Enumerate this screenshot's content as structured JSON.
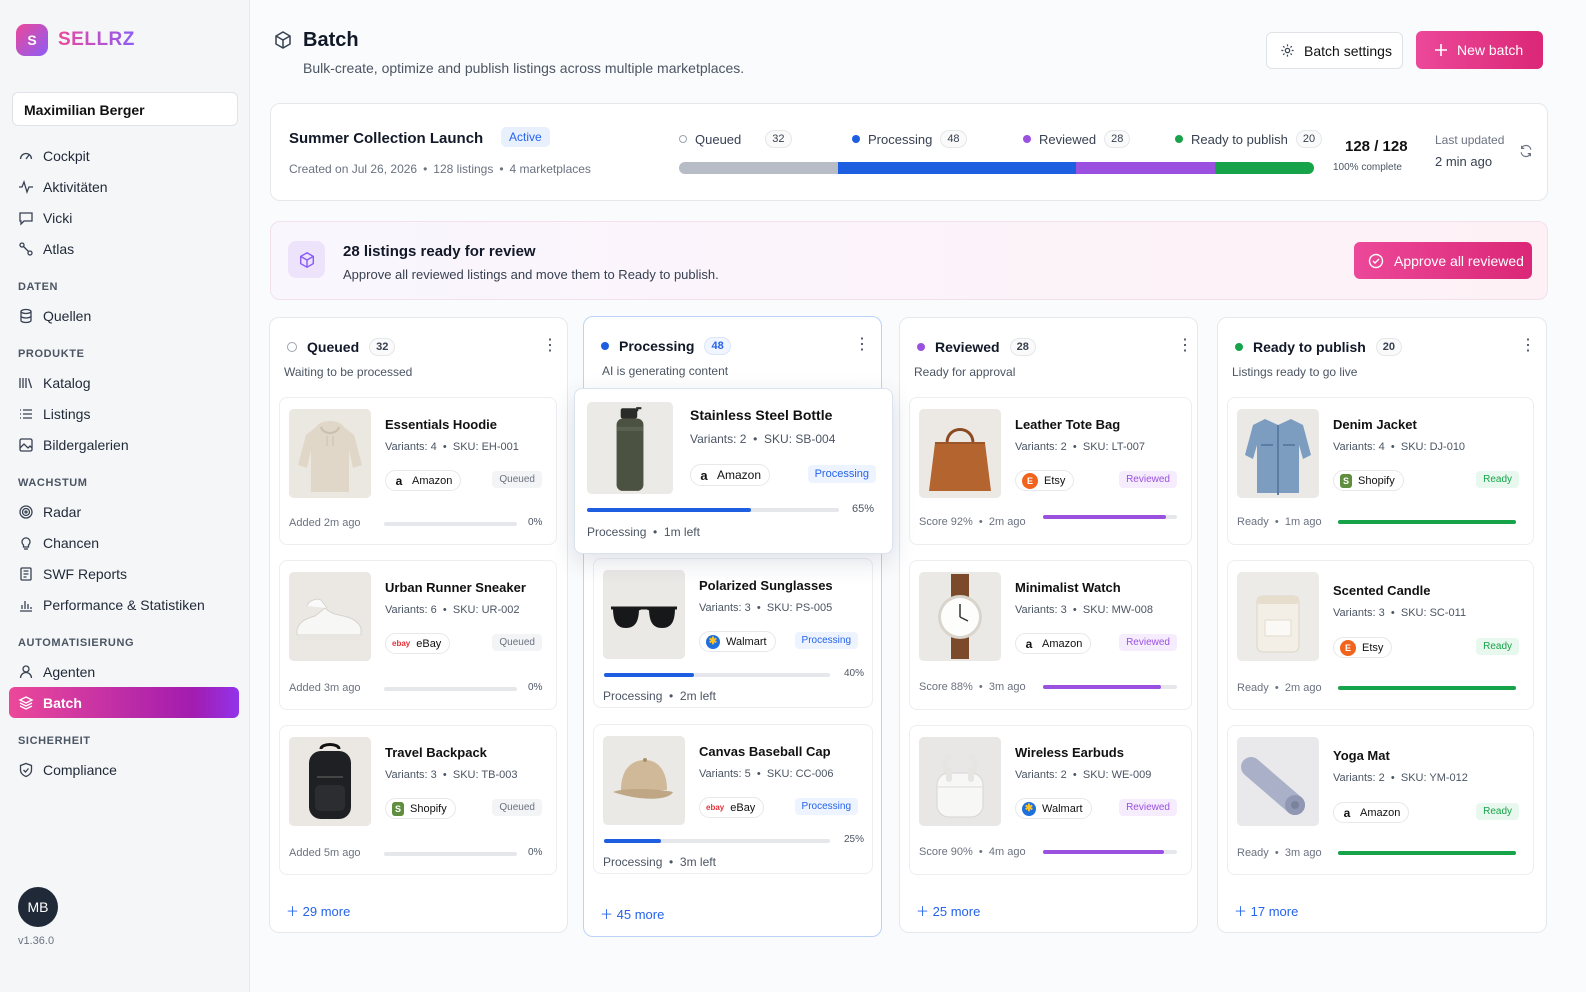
{
  "app": {
    "logo_letter": "S",
    "name": "SELLRZ",
    "user": "Maximilian Berger",
    "avatar": "MB",
    "version": "v1.36.0"
  },
  "nav": {
    "cockpit": "Cockpit",
    "aktivitaeten": "Aktivitäten",
    "vicki": "Vicki",
    "atlas": "Atlas",
    "sec_daten": "DATEN",
    "quellen": "Quellen",
    "sec_produkte": "PRODUKTE",
    "katalog": "Katalog",
    "listings": "Listings",
    "bildergalerien": "Bildergalerien",
    "sec_wachstum": "WACHSTUM",
    "radar": "Radar",
    "chancen": "Chancen",
    "swf": "SWF Reports",
    "perf": "Performance & Statistiken",
    "sec_auto": "AUTOMATISIERUNG",
    "agenten": "Agenten",
    "batch": "Batch",
    "sec_sicherheit": "SICHERHEIT",
    "compliance": "Compliance"
  },
  "header": {
    "title": "Batch",
    "subtitle": "Bulk-create, optimize and publish listings across multiple marketplaces.",
    "settings": "Batch settings",
    "new_batch": "New batch"
  },
  "summary": {
    "name": "Summer Collection Launch",
    "status": "Active",
    "created": "Created on Jul 26, 2026",
    "listings": "128 listings",
    "marketplaces": "4 marketplaces",
    "legend": [
      {
        "label": "Queued",
        "count": "32"
      },
      {
        "label": "Processing",
        "count": "48"
      },
      {
        "label": "Reviewed",
        "count": "28"
      },
      {
        "label": "Ready to publish",
        "count": "20"
      }
    ],
    "segments": [
      32,
      48,
      28,
      20
    ],
    "total": "128 / 128",
    "complete": "100% complete",
    "updated_label": "Last updated",
    "updated_value": "2 min ago"
  },
  "banner": {
    "title": "28 listings ready for review",
    "subtitle": "Approve all reviewed listings and move them to Ready to publish.",
    "button": "Approve all reviewed"
  },
  "columns": {
    "queued": {
      "title": "Queued",
      "count": "32",
      "sub": "Waiting to be processed",
      "more": "29 more",
      "cards": [
        {
          "title": "Essentials Hoodie",
          "variants": "Variants: 4",
          "sku": "SKU: EH-001",
          "market": "Amazon",
          "status": "Queued",
          "foot": "Added 2m ago",
          "pct": "0%",
          "progress": 0
        },
        {
          "title": "Urban Runner Sneaker",
          "variants": "Variants: 6",
          "sku": "SKU: UR-002",
          "market": "eBay",
          "status": "Queued",
          "foot": "Added 3m ago",
          "pct": "0%",
          "progress": 0
        },
        {
          "title": "Travel Backpack",
          "variants": "Variants: 3",
          "sku": "SKU: TB-003",
          "market": "Shopify",
          "status": "Queued",
          "foot": "Added 5m ago",
          "pct": "0%",
          "progress": 0
        }
      ]
    },
    "processing": {
      "title": "Processing",
      "count": "48",
      "sub": "AI is generating content",
      "more": "45 more",
      "cards": [
        {
          "title": "Stainless Steel Bottle",
          "variants": "Variants: 2",
          "sku": "SKU: SB-004",
          "market": "Amazon",
          "status": "Processing",
          "foot": "Processing",
          "left": "1m left",
          "pct": "65%",
          "progress": 0.65
        },
        {
          "title": "Polarized Sunglasses",
          "variants": "Variants: 3",
          "sku": "SKU: PS-005",
          "market": "Walmart",
          "status": "Processing",
          "foot": "Processing",
          "left": "2m left",
          "pct": "40%",
          "progress": 0.4
        },
        {
          "title": "Canvas Baseball Cap",
          "variants": "Variants: 5",
          "sku": "SKU: CC-006",
          "market": "eBay",
          "status": "Processing",
          "foot": "Processing",
          "left": "3m left",
          "pct": "25%",
          "progress": 0.25
        }
      ]
    },
    "reviewed": {
      "title": "Reviewed",
      "count": "28",
      "sub": "Ready for approval",
      "more": "25 more",
      "cards": [
        {
          "title": "Leather Tote Bag",
          "variants": "Variants: 2",
          "sku": "SKU: LT-007",
          "market": "Etsy",
          "status": "Reviewed",
          "score": "Score 92%",
          "ago": "2m ago",
          "progress": 0.92
        },
        {
          "title": "Minimalist Watch",
          "variants": "Variants: 3",
          "sku": "SKU: MW-008",
          "market": "Amazon",
          "status": "Reviewed",
          "score": "Score 88%",
          "ago": "3m ago",
          "progress": 0.88
        },
        {
          "title": "Wireless Earbuds",
          "variants": "Variants: 2",
          "sku": "SKU: WE-009",
          "market": "Walmart",
          "status": "Reviewed",
          "score": "Score 90%",
          "ago": "4m ago",
          "progress": 0.9
        }
      ]
    },
    "ready": {
      "title": "Ready to publish",
      "count": "20",
      "sub": "Listings ready to go live",
      "more": "17 more",
      "cards": [
        {
          "title": "Denim Jacket",
          "variants": "Variants: 4",
          "sku": "SKU: DJ-010",
          "market": "Shopify",
          "status": "Ready",
          "foot": "Ready",
          "ago": "1m ago",
          "progress": 1
        },
        {
          "title": "Scented Candle",
          "variants": "Variants: 3",
          "sku": "SKU: SC-011",
          "market": "Etsy",
          "status": "Ready",
          "foot": "Ready",
          "ago": "2m ago",
          "progress": 1
        },
        {
          "title": "Yoga Mat",
          "variants": "Variants: 2",
          "sku": "SKU: YM-012",
          "market": "Amazon",
          "status": "Ready",
          "foot": "Ready",
          "ago": "3m ago",
          "progress": 1
        }
      ]
    }
  },
  "colors": {
    "queued": "#b8bcc6",
    "processing": "#1d5fe0",
    "reviewed": "#9b51e0",
    "ready": "#16a34a",
    "accent": "#ec4899"
  }
}
